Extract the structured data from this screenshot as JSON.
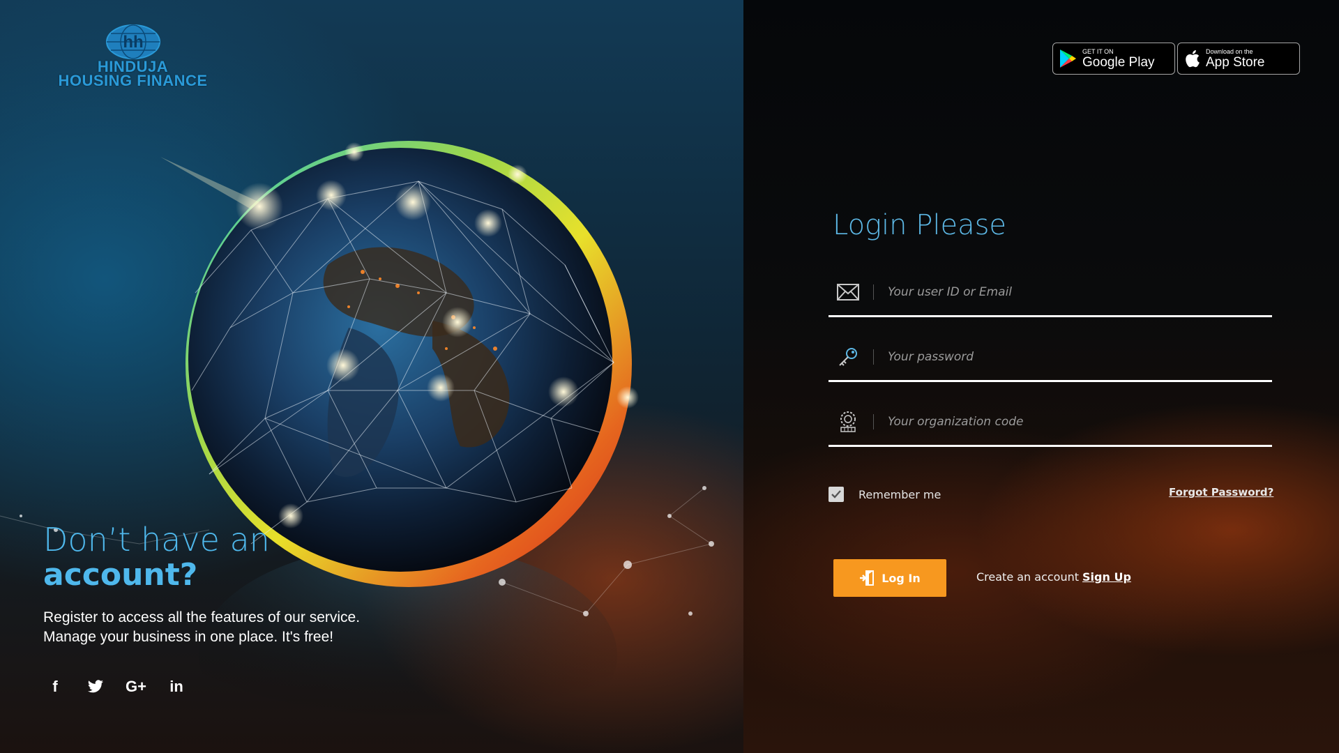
{
  "brand": {
    "line1": "HINDUJA",
    "line2": "HOUSING FINANCE",
    "color": "#2a9ad8"
  },
  "promo": {
    "title_line1": "Don’t have an",
    "title_line2": "account?",
    "text_line1": "Register to access all the features of our service.",
    "text_line2": "Manage your business in one place. It's free!"
  },
  "social": [
    {
      "name": "facebook-icon",
      "glyph": "f"
    },
    {
      "name": "twitter-icon",
      "glyph": ""
    },
    {
      "name": "google-plus-icon",
      "glyph": "G+"
    },
    {
      "name": "linkedin-icon",
      "glyph": "in"
    }
  ],
  "stores": {
    "google": {
      "small": "GET IT ON",
      "big": "Google Play"
    },
    "apple": {
      "small": "Download on the",
      "big": "App Store"
    }
  },
  "login": {
    "title": "Login Please",
    "user_placeholder": "Your user ID or Email",
    "password_placeholder": "Your password",
    "org_placeholder": "Your organization code",
    "remember_label": "Remember me",
    "remember_checked": true,
    "forgot_label": "Forgot Password?",
    "login_button": "Log In",
    "signup_prompt": "Create an account",
    "signup_link": "Sign Up"
  },
  "colors": {
    "accent_blue": "#5db8e6",
    "button_orange": "#f7981f"
  }
}
